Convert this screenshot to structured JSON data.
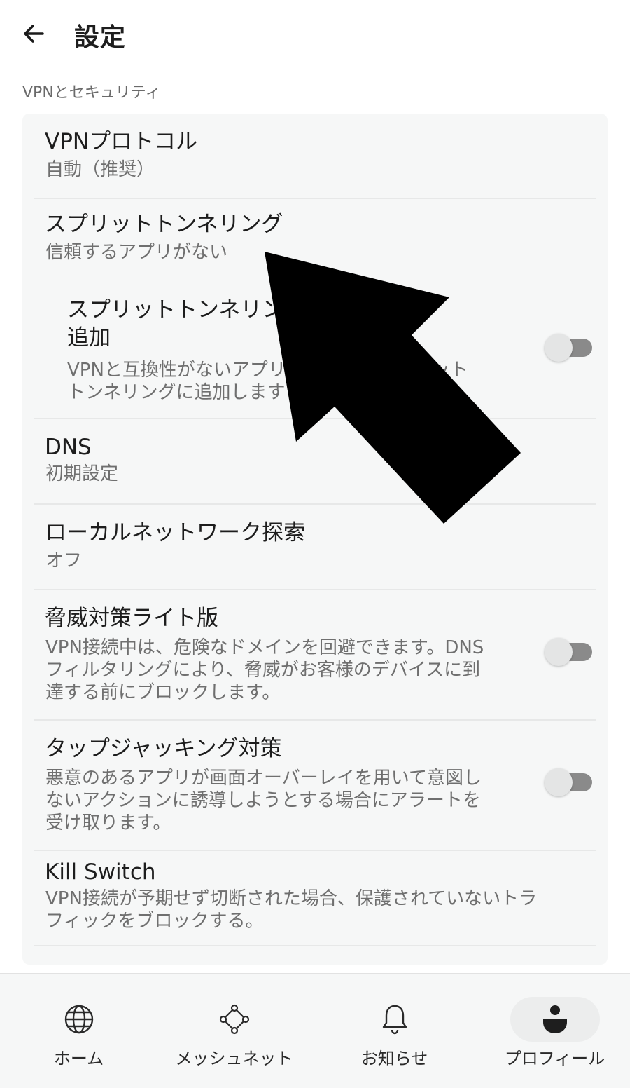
{
  "header": {
    "title": "設定",
    "back_icon": "arrow-left-icon"
  },
  "section": {
    "label": "VPNとセキュリティ"
  },
  "settings": {
    "vpn_protocol": {
      "title": "VPNプロトコル",
      "value": "自動（推奨）"
    },
    "split_tunneling": {
      "title": "スプリットトンネリング",
      "value": "信頼するアプリがない"
    },
    "auto_add": {
      "title": "スプリットトンネリングに自動的に\n追加",
      "desc": "VPNと互換性がないアプリを自動的にスプリット\nトンネリングに追加します",
      "enabled": false
    },
    "dns": {
      "title": "DNS",
      "value": "初期設定"
    },
    "lan_discovery": {
      "title": "ローカルネットワーク探索",
      "value": "オフ"
    },
    "threat_protection": {
      "title": "脅威対策ライト版",
      "desc": "VPN接続中は、危険なドメインを回避できます。DNS\nフィルタリングにより、脅威がお客様のデバイスに到\n達する前にブロックします。",
      "enabled": false
    },
    "tapjacking": {
      "title": "タップジャッキング対策",
      "desc": "悪意のあるアプリが画面オーバーレイを用いて意図し\nないアクションに誘導しようとする場合にアラートを\n受け取ります。",
      "enabled": false
    },
    "kill_switch": {
      "title": "Kill Switch",
      "desc": "VPN接続が予期せず切断された場合、保護されていないトラ\nフィックをブロックする。"
    }
  },
  "bottom_nav": {
    "items": [
      {
        "label": "ホーム",
        "icon": "globe-icon",
        "active": false
      },
      {
        "label": "メッシュネット",
        "icon": "meshnet-icon",
        "active": false
      },
      {
        "label": "お知らせ",
        "icon": "bell-icon",
        "active": false
      },
      {
        "label": "プロフィール",
        "icon": "profile-icon",
        "active": true
      }
    ]
  },
  "colors": {
    "background": "#ffffff",
    "card": "#f6f7f7",
    "toggle_off_track": "#8a8a8a",
    "toggle_off_thumb": "#e4e5e5",
    "overlay_arrow": "#000000"
  }
}
